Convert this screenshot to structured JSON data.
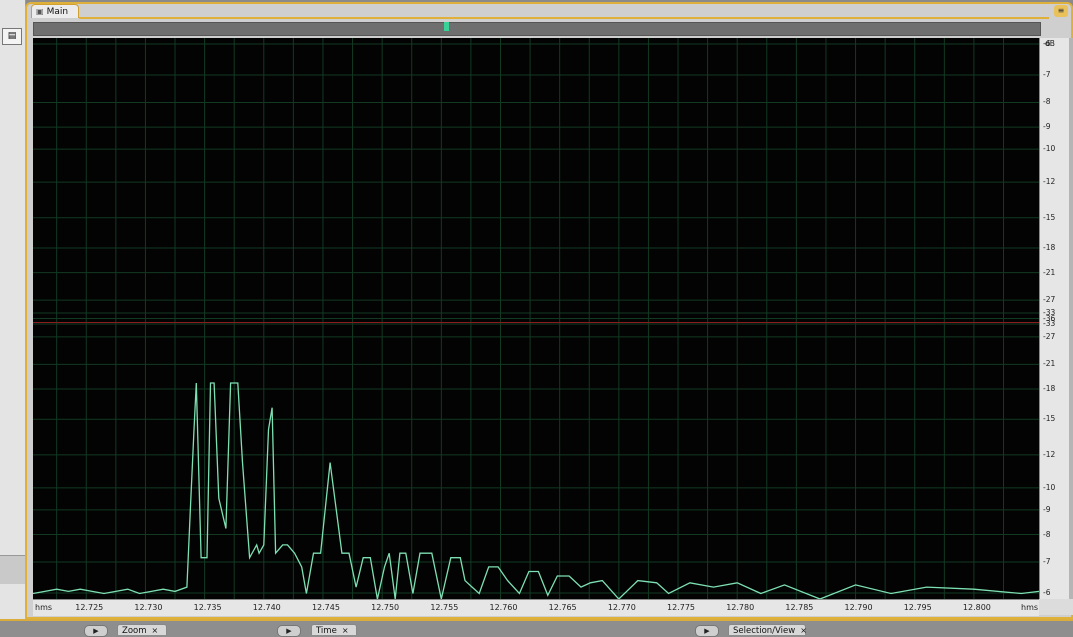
{
  "window": {
    "main_tab_label": "Main"
  },
  "bottom_tabs": [
    {
      "label": "Zoom",
      "close": "×"
    },
    {
      "label": "Time",
      "close": "×"
    },
    {
      "label": "Selection/View",
      "close": "×"
    }
  ],
  "colors": {
    "plot_background": "#030303",
    "grid": "#123a23",
    "trace": "#7de0b2",
    "center_line": "#8a1c1c",
    "panel_accent": "#e0b13a"
  },
  "icons": {
    "play": "▶",
    "tab_icon": "▣"
  },
  "chart_data": {
    "type": "line",
    "x_unit_label": "hms",
    "y_unit_label": "dB",
    "x_tick_labels": [
      "12.725",
      "12.730",
      "12.735",
      "12.740",
      "12.745",
      "12.750",
      "12.755",
      "12.760",
      "12.765",
      "12.770",
      "12.775",
      "12.780",
      "12.785",
      "12.790",
      "12.795",
      "12.800"
    ],
    "xlim": [
      12.7205,
      12.8055
    ],
    "y_tick_labels": [
      "-6",
      "-7",
      "-8",
      "-9",
      "-10",
      "-12",
      "-15",
      "-18",
      "-21",
      "-27",
      "-33",
      "-36",
      "-33",
      "-27",
      "-21",
      "-18",
      "-15",
      "-12",
      "-10",
      "-9",
      "-8",
      "-7",
      "-6"
    ],
    "grid": true,
    "series": [
      {
        "x": [
          12.7205,
          12.7215,
          12.7225,
          12.7235,
          12.7245,
          12.7255,
          12.7265,
          12.7275,
          12.7285,
          12.7295,
          12.7305,
          12.7315,
          12.7325,
          12.7335,
          12.7338,
          12.7341,
          12.7343,
          12.7347,
          12.7352,
          12.7355,
          12.7358,
          12.7362,
          12.7368,
          12.7372,
          12.7378,
          12.7382,
          12.7388,
          12.7394,
          12.7396,
          12.74,
          12.7404,
          12.7407,
          12.741,
          12.7416,
          12.742,
          12.7426,
          12.7432,
          12.7436,
          12.7442,
          12.7448,
          12.7456,
          12.7466,
          12.7472,
          12.7478,
          12.7484,
          12.749,
          12.7496,
          12.7502,
          12.7506,
          12.7511,
          12.7515,
          12.752,
          12.7526,
          12.7532,
          12.7542,
          12.755,
          12.7558,
          12.7566,
          12.757,
          12.7576,
          12.7582,
          12.759,
          12.7598,
          12.7606,
          12.7616,
          12.7624,
          12.7632,
          12.764,
          12.7648,
          12.7658,
          12.7668,
          12.7676,
          12.7686,
          12.77,
          12.7716,
          12.7732,
          12.7742,
          12.776,
          12.778,
          12.78,
          12.782,
          12.784,
          12.787,
          12.79,
          12.793,
          12.796,
          12.8,
          12.804,
          12.8055
        ],
        "y": [
          -33,
          -32,
          -31,
          -32,
          -31,
          -32,
          -33,
          -32,
          -31,
          -33,
          -32,
          -31,
          -32,
          -30,
          -16,
          -10,
          -8,
          -22,
          -22,
          -8,
          -8,
          -15,
          -18,
          -8,
          -8,
          -12,
          -22,
          -20,
          -21,
          -20,
          -10,
          -9,
          -21,
          -20,
          -20,
          -21,
          -24,
          -33,
          -21,
          -21,
          -12,
          -21,
          -21,
          -30,
          -22,
          -22,
          -36,
          -24,
          -21,
          -36,
          -21,
          -21,
          -33,
          -21,
          -21,
          -36,
          -22,
          -22,
          -27,
          -30,
          -33,
          -24,
          -24,
          -27,
          -33,
          -25,
          -25,
          -34,
          -26,
          -26,
          -30,
          -28,
          -27,
          -36,
          -27,
          -28,
          -33,
          -28,
          -30,
          -28,
          -33,
          -29,
          -36,
          -29,
          -33,
          -30,
          -31,
          -33,
          -32
        ]
      }
    ]
  }
}
